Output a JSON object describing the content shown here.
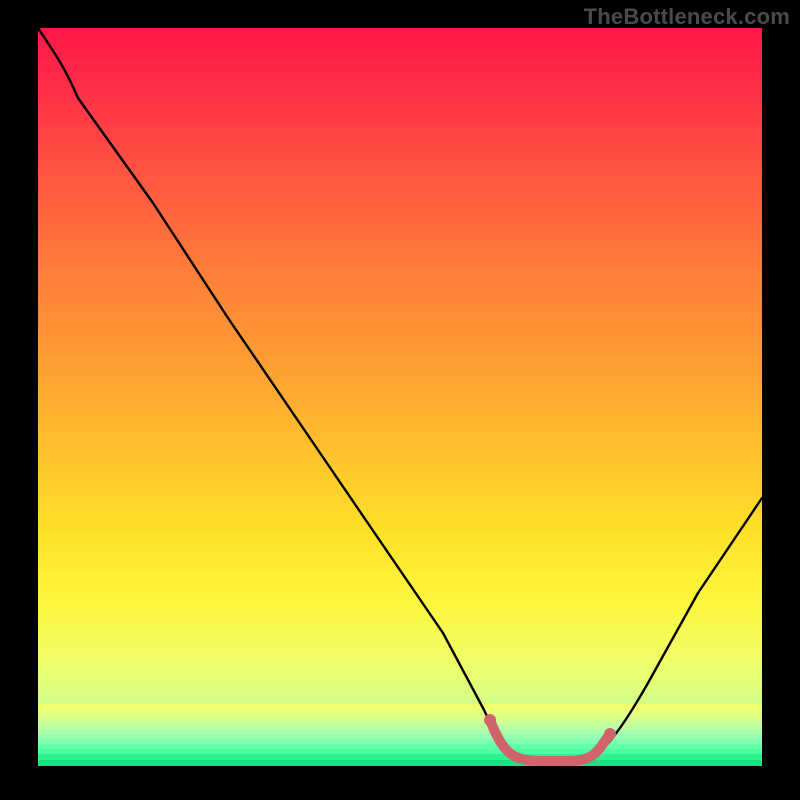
{
  "watermark": "TheBottleneck.com",
  "chart_data": {
    "type": "line",
    "title": "",
    "xlabel": "",
    "ylabel": "",
    "xlim": [
      0,
      100
    ],
    "ylim": [
      0,
      100
    ],
    "grid": false,
    "legend": false,
    "background": "green-yellow-red vertical gradient (bottleneck heatmap)",
    "series": [
      {
        "name": "bottleneck-curve",
        "color": "#000000",
        "x": [
          0,
          4,
          10,
          20,
          30,
          40,
          50,
          58,
          62,
          64,
          72,
          76,
          80,
          86,
          92,
          100
        ],
        "y": [
          100,
          95,
          86,
          71,
          55.5,
          40,
          24.5,
          12,
          5,
          2,
          1,
          2,
          5,
          12,
          21,
          36
        ]
      },
      {
        "name": "optimal-range-marker",
        "color": "#d1646a",
        "x": [
          62,
          64,
          72,
          76
        ],
        "y": [
          5,
          2,
          1,
          2
        ]
      }
    ],
    "annotations": []
  },
  "colors": {
    "frame": "#000000",
    "watermark": "#4a4a4a",
    "curve": "#000000",
    "marker": "#d1646a"
  }
}
